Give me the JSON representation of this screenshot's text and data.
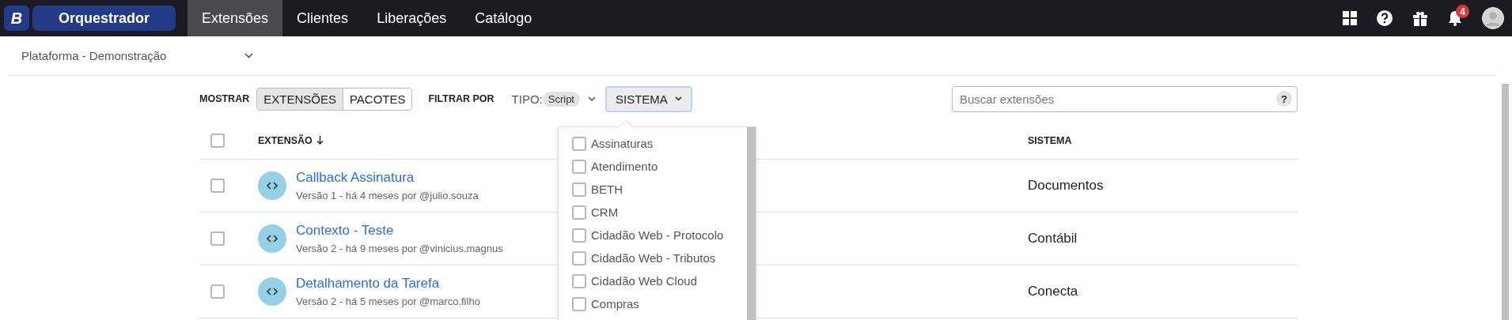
{
  "top_bar": {
    "logo": "B",
    "app_name": "Orquestrador",
    "nav": [
      {
        "label": "Extensões",
        "selected": true
      },
      {
        "label": "Clientes",
        "selected": false
      },
      {
        "label": "Liberações",
        "selected": false
      },
      {
        "label": "Catálogo",
        "selected": false
      }
    ],
    "notification_count": "4"
  },
  "workspace": {
    "label": "Plataforma - Demonstração"
  },
  "filters": {
    "show_label": "MOSTRAR",
    "show_options": [
      {
        "label": "EXTENSÕES",
        "selected": true
      },
      {
        "label": "PACOTES",
        "selected": false
      }
    ],
    "filter_label": "FILTRAR POR",
    "type_label": "TIPO:",
    "type_value": "Script",
    "system_button": "SISTEMA",
    "system_open": true
  },
  "search": {
    "placeholder": "Buscar extensões",
    "help": "?"
  },
  "table": {
    "select_all_checked": false,
    "columns": [
      "EXTENSÃO",
      "SISTEMA"
    ],
    "rows": [
      {
        "checked": false,
        "name": "Callback Assinatura",
        "meta": "Versão 1 - há 4 meses por @julio.souza",
        "system": "Documentos"
      },
      {
        "checked": false,
        "name": "Contexto - Teste",
        "meta": "Versão 2 - há 9 meses por @vinicius.magnus",
        "system": "Contábil"
      },
      {
        "checked": false,
        "name": "Detalhamento da Tarefa",
        "meta": "Versão 2 - há 5 meses por @marco.filho",
        "system": "Conecta"
      }
    ]
  },
  "system_menu": {
    "options": [
      {
        "label": "Assinaturas",
        "checked": false
      },
      {
        "label": "Atendimento",
        "checked": false
      },
      {
        "label": "BETH",
        "checked": false
      },
      {
        "label": "CRM",
        "checked": false
      },
      {
        "label": "Cidadão Web - Protocolo",
        "checked": false
      },
      {
        "label": "Cidadão Web - Tributos",
        "checked": false
      },
      {
        "label": "Cidadão Web Cloud",
        "checked": false
      },
      {
        "label": "Compras",
        "checked": false
      }
    ]
  }
}
